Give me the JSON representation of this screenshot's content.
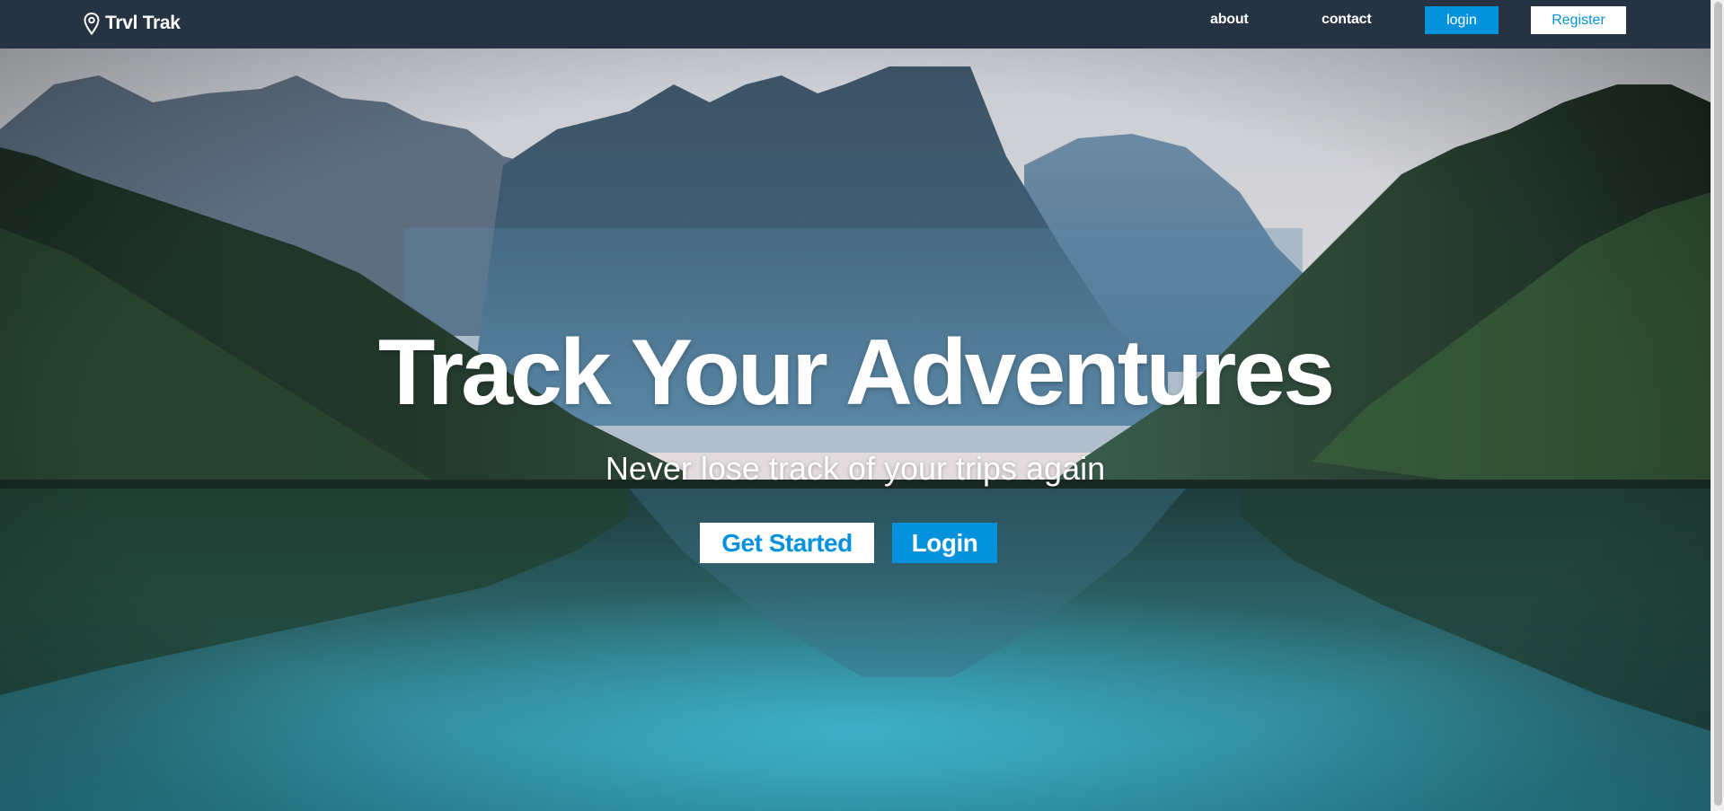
{
  "navbar": {
    "brand": "Trvl Trak",
    "brand_icon": "map-pin-icon",
    "links": {
      "about": "about",
      "contact": "contact"
    },
    "login_label": "login",
    "register_label": "Register"
  },
  "hero": {
    "title": "Track Your Adventures",
    "subtitle": "Never lose track of your trips again",
    "get_started_label": "Get Started",
    "login_label": "Login"
  },
  "colors": {
    "navbar_bg": "#263343",
    "accent": "#0592dc",
    "text_on_dark": "#ffffff"
  }
}
